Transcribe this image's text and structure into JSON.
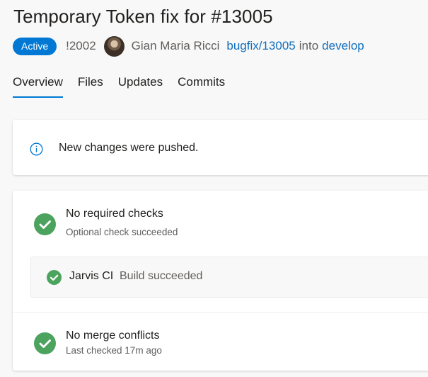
{
  "pr": {
    "title": "Temporary Token fix for #13005",
    "status": "Active",
    "id": "!2002",
    "author": "Gian Maria Ricci",
    "source_branch": "bugfix/13005",
    "into_text": "into",
    "target_branch": "develop"
  },
  "tabs": [
    {
      "label": "Overview",
      "active": true
    },
    {
      "label": "Files"
    },
    {
      "label": "Updates"
    },
    {
      "label": "Commits"
    }
  ],
  "notice": {
    "text": "New changes were pushed.",
    "icon": "info-icon"
  },
  "checks": {
    "required": {
      "title": "No required checks",
      "subtitle": "Optional check succeeded"
    },
    "ci": {
      "name": "Jarvis CI",
      "status": "Build succeeded"
    },
    "merge": {
      "title": "No merge conflicts",
      "subtitle": "Last checked 17m ago"
    }
  },
  "colors": {
    "accent": "#0078d4",
    "success": "#4ca35e",
    "link": "#106ebe"
  }
}
